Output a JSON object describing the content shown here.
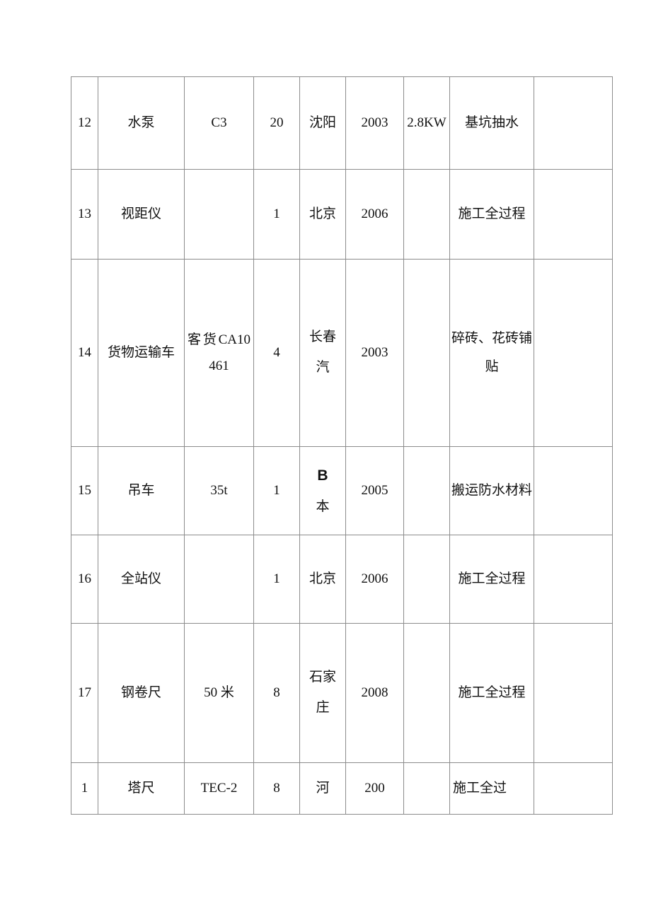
{
  "document": {
    "type": "equipment-schedule-table",
    "page_background": "#ffffff",
    "border_color": "#8c8c8c",
    "text_color": "#111111"
  },
  "table": {
    "column_count": 9,
    "columns": [
      "no",
      "name",
      "model",
      "quantity",
      "origin",
      "year",
      "power",
      "use",
      "note"
    ],
    "rows": [
      {
        "no": "12",
        "name": "水泵",
        "model": "C3",
        "quantity": "20",
        "origin": "沈阳",
        "year": "2003",
        "power": "2.8KW",
        "use": "基坑抽水",
        "note": ""
      },
      {
        "no": "13",
        "name": "视距仪",
        "model": "",
        "quantity": "1",
        "origin": "北京",
        "year": "2006",
        "power": "",
        "use": "施工全过程",
        "note": ""
      },
      {
        "no": "14",
        "name": "货物运输车",
        "model": "客货CA10461",
        "quantity": "4",
        "origin": "长春汽",
        "year": "2003",
        "power": "",
        "use": "碎砖、花砖铺贴",
        "note": ""
      },
      {
        "no": "15",
        "name": "吊车",
        "model": "35t",
        "quantity": "1",
        "origin_latin": "B",
        "origin_cjk": "本",
        "origin": "B本",
        "year": "2005",
        "power": "",
        "use": "搬运防水材料",
        "note": ""
      },
      {
        "no": "16",
        "name": "全站仪",
        "model": "",
        "quantity": "1",
        "origin": "北京",
        "year": "2006",
        "power": "",
        "use": "施工全过程",
        "note": ""
      },
      {
        "no": "17",
        "name": "钢卷尺",
        "model": "50 米",
        "quantity": "8",
        "origin": "石家庄",
        "year": "2008",
        "power": "",
        "use": "施工全过程",
        "note": ""
      },
      {
        "no": "1",
        "name": "塔尺",
        "model": "TEC-2",
        "quantity": "8",
        "origin": "河",
        "year": "200",
        "power": "",
        "use": "施工全过",
        "note": ""
      }
    ]
  }
}
